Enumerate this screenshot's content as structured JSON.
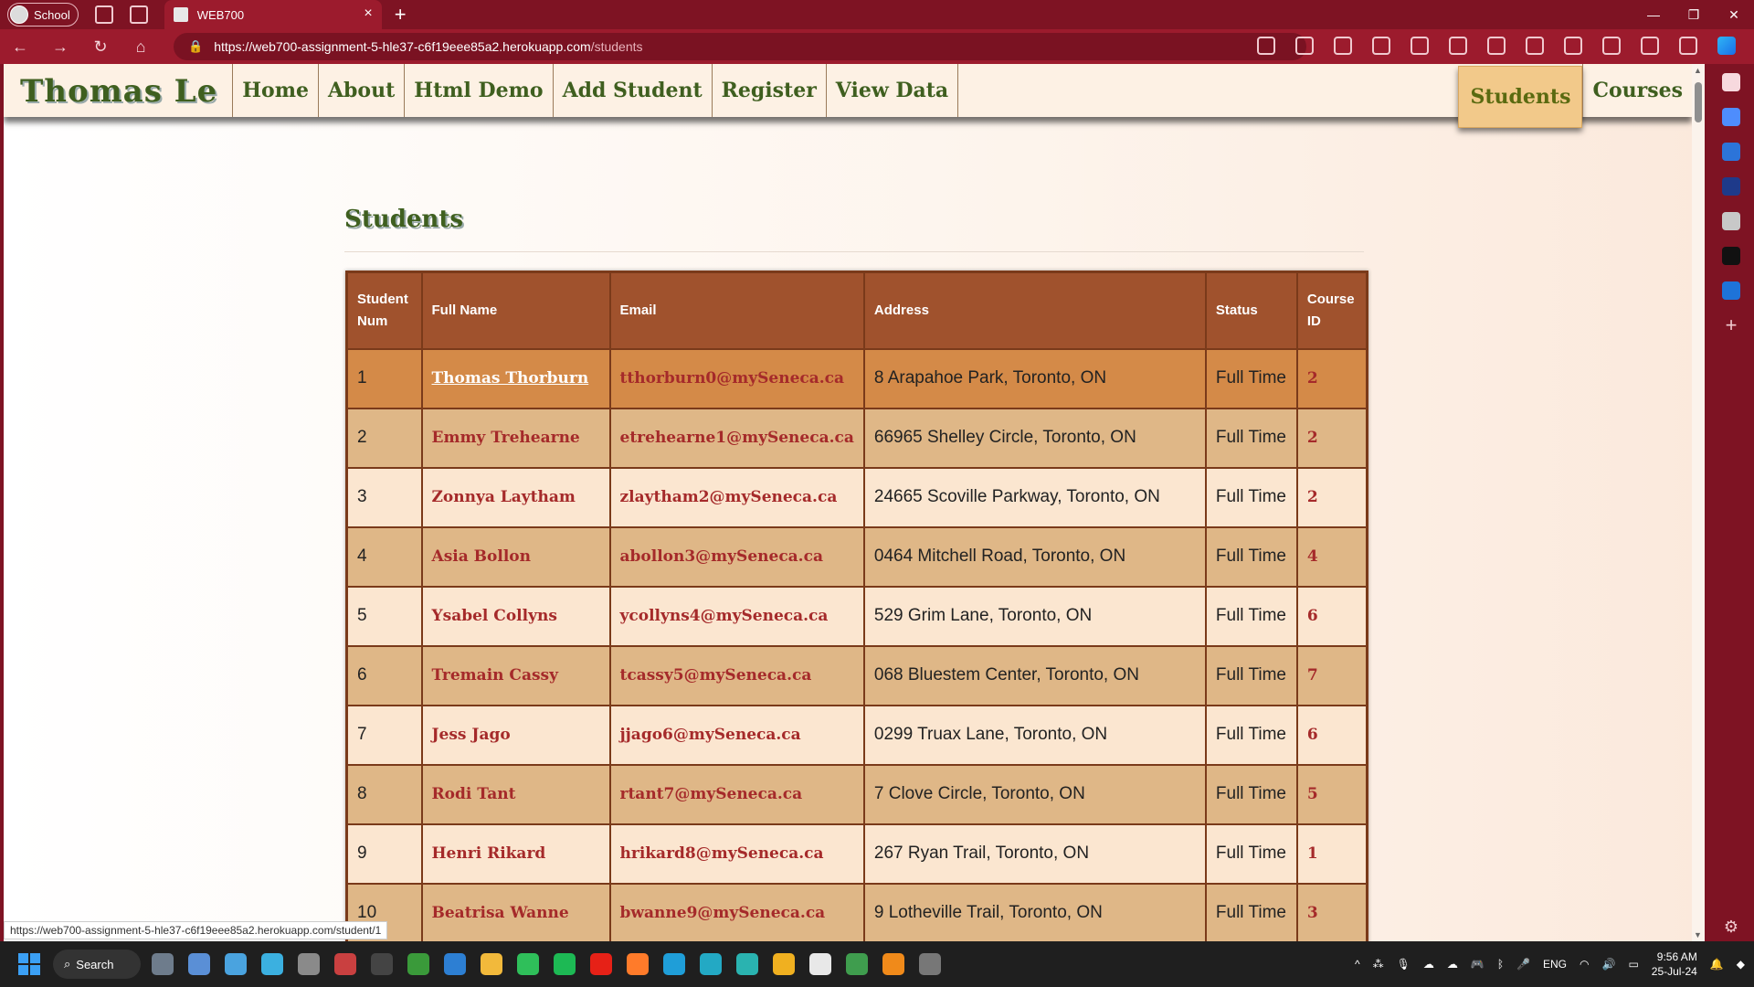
{
  "browser": {
    "profile_label": "School",
    "tab_title": "WEB700",
    "url_host": "https://web700-assignment-5-hle37-c6f19eee85a2.herokuapp.com",
    "url_path": "/students",
    "status_url": "https://web700-assignment-5-hle37-c6f19eee85a2.herokuapp.com/student/1"
  },
  "site": {
    "brand": "Thomas Le",
    "nav": [
      "Home",
      "About",
      "Html Demo",
      "Add Student",
      "Register",
      "View Data"
    ],
    "nav_right": {
      "active": "Students",
      "next": "Courses"
    }
  },
  "page": {
    "heading": "Students",
    "columns": [
      "Student Num",
      "Full Name",
      "Email",
      "Address",
      "Status",
      "Course ID"
    ],
    "rows": [
      {
        "num": "1",
        "name": "Thomas Thorburn",
        "email": "tthorburn0@mySeneca.ca",
        "address": "8 Arapahoe Park, Toronto, ON",
        "status": "Full Time",
        "course": "2"
      },
      {
        "num": "2",
        "name": "Emmy Trehearne",
        "email": "etrehearne1@mySeneca.ca",
        "address": "66965 Shelley Circle, Toronto, ON",
        "status": "Full Time",
        "course": "2"
      },
      {
        "num": "3",
        "name": "Zonnya Laytham",
        "email": "zlaytham2@mySeneca.ca",
        "address": "24665 Scoville Parkway, Toronto, ON",
        "status": "Full Time",
        "course": "2"
      },
      {
        "num": "4",
        "name": "Asia Bollon",
        "email": "abollon3@mySeneca.ca",
        "address": "0464 Mitchell Road, Toronto, ON",
        "status": "Full Time",
        "course": "4"
      },
      {
        "num": "5",
        "name": "Ysabel Collyns",
        "email": "ycollyns4@mySeneca.ca",
        "address": "529 Grim Lane, Toronto, ON",
        "status": "Full Time",
        "course": "6"
      },
      {
        "num": "6",
        "name": "Tremain Cassy",
        "email": "tcassy5@mySeneca.ca",
        "address": "068 Bluestem Center, Toronto, ON",
        "status": "Full Time",
        "course": "7"
      },
      {
        "num": "7",
        "name": "Jess Jago",
        "email": "jjago6@mySeneca.ca",
        "address": "0299 Truax Lane, Toronto, ON",
        "status": "Full Time",
        "course": "6"
      },
      {
        "num": "8",
        "name": "Rodi Tant",
        "email": "rtant7@mySeneca.ca",
        "address": "7 Clove Circle, Toronto, ON",
        "status": "Full Time",
        "course": "5"
      },
      {
        "num": "9",
        "name": "Henri Rikard",
        "email": "hrikard8@mySeneca.ca",
        "address": "267 Ryan Trail, Toronto, ON",
        "status": "Full Time",
        "course": "1"
      },
      {
        "num": "10",
        "name": "Beatrisa Wanne",
        "email": "bwanne9@mySeneca.ca",
        "address": "9 Lotheville Trail, Toronto, ON",
        "status": "Full Time",
        "course": "3"
      }
    ]
  },
  "taskbar": {
    "search_label": "Search",
    "lang": "ENG",
    "time": "9:56 AM",
    "date": "25-Jul-24"
  },
  "colors": {
    "browser_frame": "#7e1323",
    "header_row": "#a0522d",
    "link": "#a52a2a",
    "brand_green": "#3f5f1f"
  }
}
